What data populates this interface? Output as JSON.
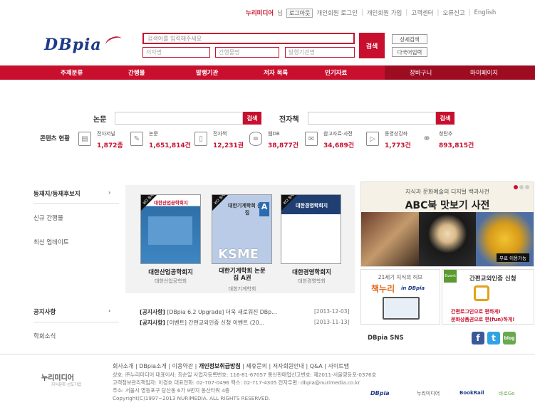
{
  "util": {
    "brand": "누리미디어",
    "sir": "님",
    "logout": "로그아웃",
    "links": [
      "개인회원 로그인",
      "개인회원 가입",
      "고객센터",
      "오류신고",
      "English"
    ]
  },
  "logo": {
    "text": "DBpia"
  },
  "search": {
    "main_placeholder": "검색어를 입력해주세요",
    "author_placeholder": "저자명",
    "journal_placeholder": "간행물명",
    "publisher_placeholder": "발행기관명",
    "button": "검색",
    "detail": "상세검색",
    "multi": "다국어입력"
  },
  "nav": {
    "items": [
      "주제분류",
      "간행물",
      "발행기관",
      "저자 목록",
      "인기자료",
      "장바구니",
      "마이페이지"
    ]
  },
  "quick_search": {
    "paper_label": "논문",
    "ebook_label": "전자책",
    "button": "검색"
  },
  "contents_status": {
    "label": "콘텐츠 현황",
    "items": [
      {
        "icon": "document-icon",
        "name": "전자저널",
        "value": "1,872종"
      },
      {
        "icon": "pencil-icon",
        "name": "논문",
        "value": "1,651,814건"
      },
      {
        "icon": "book-icon",
        "name": "전자책",
        "value": "12,231권"
      },
      {
        "icon": "database-icon",
        "name": "웹DB",
        "value": "38,877건"
      },
      {
        "icon": "envelope-icon",
        "name": "참고자료·사전",
        "value": "34,689건"
      },
      {
        "icon": "play-icon",
        "name": "동영상강좌",
        "value": "1,773건"
      },
      {
        "icon": "link-icon",
        "name": "청탄추",
        "value": "893,815건"
      }
    ]
  },
  "left_menu": {
    "items": [
      "등재지/등재후보지",
      "신규 간행물",
      "최신 업데이트"
    ],
    "notice": "공지사항",
    "academic": "학회소식"
  },
  "books": [
    {
      "cover_title": "대한산업공학회지",
      "title": "대한산업공학회지",
      "publisher": "대한산업공학회"
    },
    {
      "cover_title": "대한기계학회 논문집",
      "title_line1": "대한기계학회 논문",
      "title_line2": "집 A권",
      "title": "대한기계학회 논문 집 A권",
      "publisher": "대한기계학회"
    },
    {
      "cover_title": "대한경영학회지",
      "title": "대한경영학회지",
      "publisher": "대한경영학회"
    }
  ],
  "book_badge": "KCI 등재",
  "ksme": "KSME",
  "notices": [
    {
      "tag": "[공지사항]",
      "text": "[DBpia 6.2 Upgrade] 더욱 새로워진 DBp...",
      "date": "[2013-12-03]"
    },
    {
      "tag": "[공지사항]",
      "text": "[이벤트] 간편교외인증 신청 이벤트 (20...",
      "date": "[2013-11-13]"
    }
  ],
  "banner": {
    "top": "지식과 문화예술의 디지털 백과사전",
    "title": "ABC북 맛보기 사전",
    "free_tag": "무료 이용가능"
  },
  "promo1": {
    "line1": "21세기 지식의 허브",
    "brand": "책누리",
    "in": "in DBpia"
  },
  "promo2": {
    "badge": "Event",
    "title": "간편교외인증 신청",
    "line1": "간편로그인으로 편하게!",
    "line2": "문화상품권으로 편(fun)하게!"
  },
  "sns": {
    "label": "DBpia SNS",
    "facebook": "f",
    "twitter": "t",
    "blog": "blog"
  },
  "footer": {
    "logo": "누리미디어",
    "logo_sub": "지식문화 선도기업",
    "links": [
      "회사소개",
      "DBpia소개",
      "이용약관",
      "개인정보취급방침",
      "제휴문의",
      "저자회원안내",
      "Q&A",
      "사이트맵"
    ],
    "bold_link": "개인정보취급방침",
    "line1": "상호: ㈜누리미디어 대표이사: 최순일 사업자등록번호: 116-81-67057 통신판매업신고번호: 제2011-서울영등포-0376호",
    "line2": "고객정보관리책임자: 이경호 대표전화: 02-707-0496 팩스: 02-717-4305 전자우편: dbpia@nurimedia.co.kr",
    "line3": "주소: 서울시 영등포구 당산동 6가 9번지 동산타워 4층",
    "line4": "Copyright(C)1997~2013 NURIMEDIA. ALL RIGHTS RESERVED.",
    "partners": [
      "DBpia",
      "누리미디어",
      "BookRail",
      "바로Go"
    ]
  },
  "colors": {
    "accent": "#c8102e",
    "logo": "#1e3a8a"
  }
}
